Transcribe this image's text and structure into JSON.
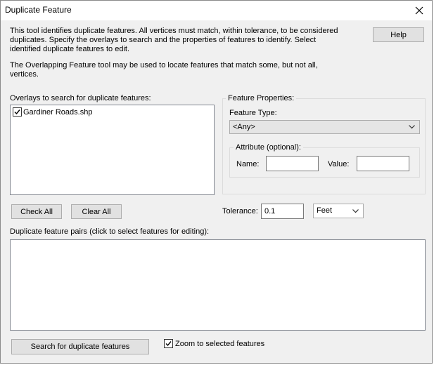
{
  "window": {
    "title": "Duplicate Feature"
  },
  "description": {
    "para1": [
      "This tool identifies duplicate features. All vertices must match, within tolerance, to be considered",
      "duplicates. Specify the overlays to search and the properties of features to identify. Select",
      "identified duplicate features to edit."
    ],
    "para2": [
      "The Overlapping Feature tool may be used to locate features that match some, but not all,",
      "vertices."
    ]
  },
  "help_button": "Help",
  "overlays": {
    "label": "Overlays to search for duplicate features:",
    "items": [
      {
        "name": "Gardiner Roads.shp",
        "checked": true
      }
    ]
  },
  "check_all": "Check All",
  "clear_all": "Clear All",
  "feature_properties": {
    "label": "Feature Properties:",
    "type_label": "Feature Type:",
    "type_value": "<Any>",
    "attribute_label": "Attribute (optional):",
    "name_label": "Name:",
    "name_value": "",
    "value_label": "Value:",
    "value_value": ""
  },
  "tolerance": {
    "label": "Tolerance:",
    "value": "0.1",
    "unit": "Feet"
  },
  "pairs_label": "Duplicate feature pairs (click to select features for editing):",
  "search_button": "Search for duplicate features",
  "zoom": {
    "label": "Zoom to selected features",
    "checked": true
  }
}
